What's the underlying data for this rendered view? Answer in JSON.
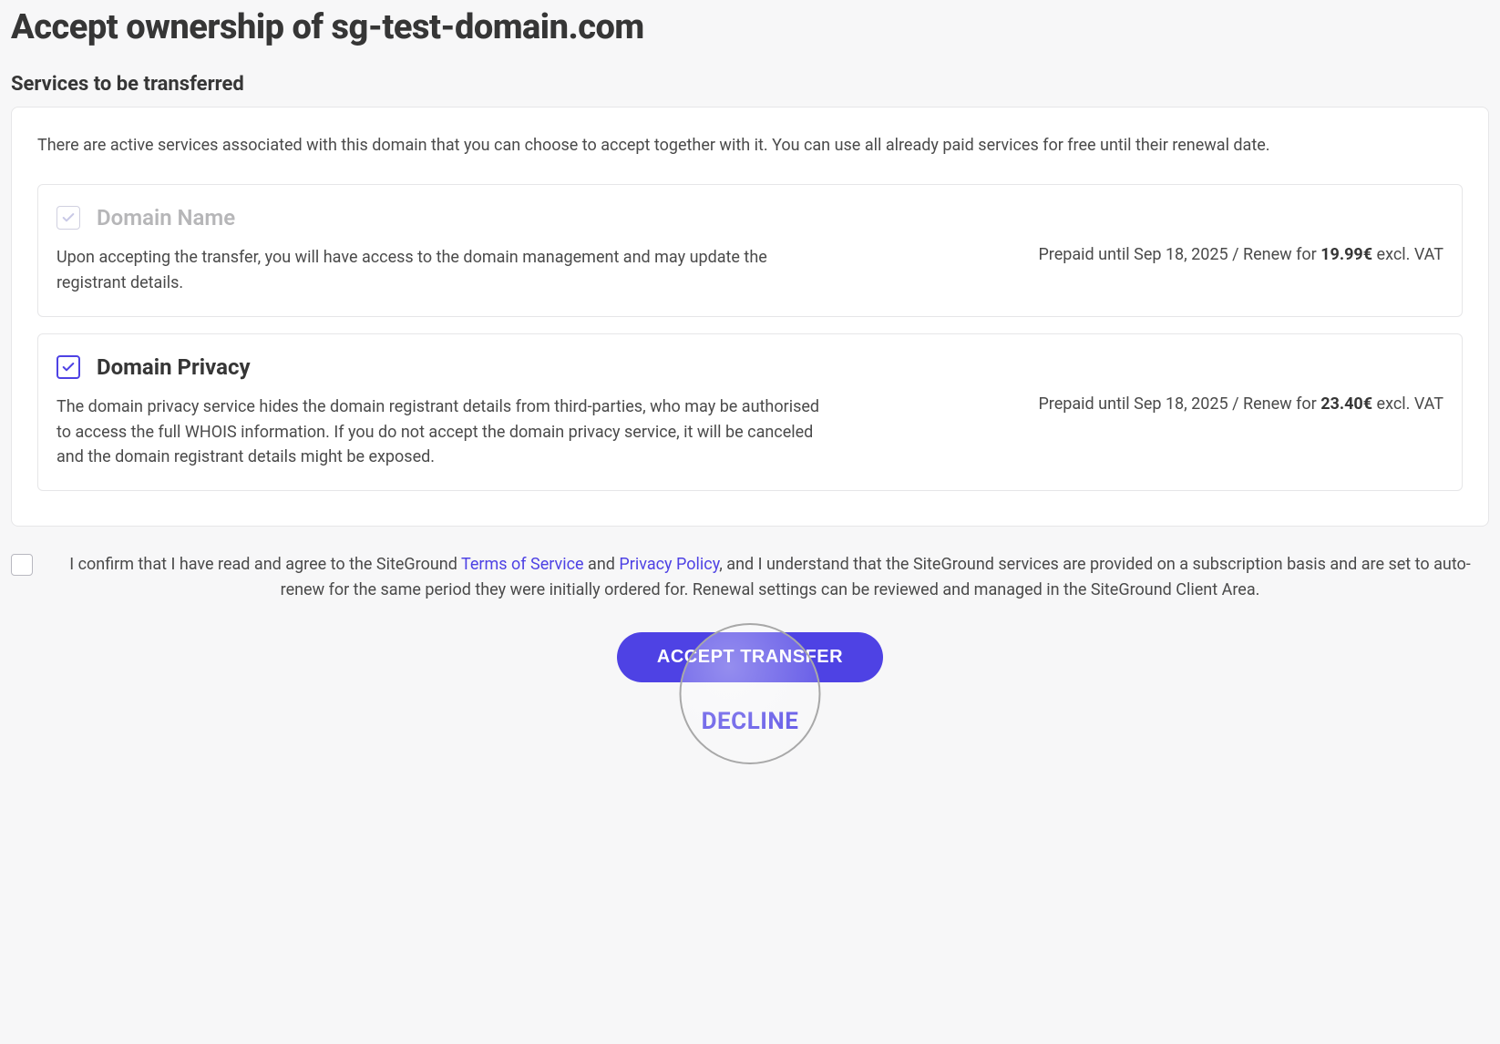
{
  "page": {
    "title": "Accept ownership of sg-test-domain.com",
    "section_title": "Services to be transferred",
    "intro": "There are active services associated with this domain that you can choose to accept together with it. You can use all already paid services for free until their renewal date."
  },
  "services": [
    {
      "title": "Domain Name",
      "desc": "Upon accepting the transfer, you will have access to the domain management and may update the registrant details.",
      "price_prefix": "Prepaid until Sep 18, 2025 / Renew for ",
      "price_value": "19.99€",
      "price_suffix": " excl. VAT",
      "checked": true,
      "locked": true
    },
    {
      "title": "Domain Privacy",
      "desc": "The domain privacy service hides the domain registrant details from third-parties, who may be authorised to access the full WHOIS information. If you do not accept the domain privacy service, it will be canceled and the domain registrant details might be exposed.",
      "price_prefix": "Prepaid until Sep 18, 2025 / Renew for ",
      "price_value": "23.40€",
      "price_suffix": " excl. VAT",
      "checked": true,
      "locked": false
    }
  ],
  "confirm": {
    "seg1": "I confirm that I have read and agree to the SiteGround ",
    "tos": "Terms of Service",
    "seg2": " and ",
    "pp": "Privacy Policy",
    "seg3": ", and I understand that the SiteGround services are provided on a subscription basis and are set to auto-renew for the same period they were initially ordered for. Renewal settings can be reviewed and managed in the SiteGround Client Area."
  },
  "actions": {
    "accept": "ACCEPT TRANSFER",
    "decline": "DECLINE"
  }
}
